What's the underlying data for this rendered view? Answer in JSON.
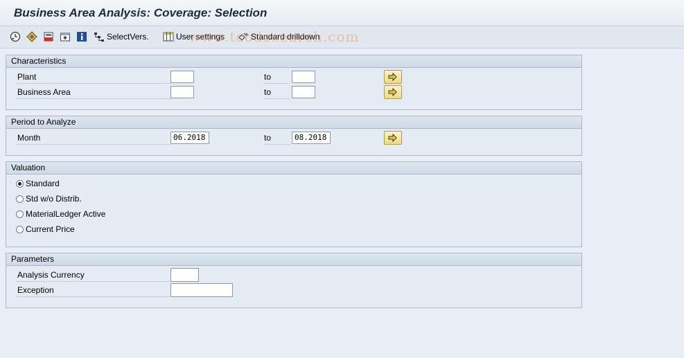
{
  "window": {
    "title": "Business Area Analysis: Coverage: Selection"
  },
  "toolbar": {
    "select_versions_label": "SelectVers.",
    "user_settings_label": "User settings",
    "standard_drilldown_label": "Standard drilldown"
  },
  "watermark": "www.tcodesearch.com",
  "characteristics": {
    "header": "Characteristics",
    "plant_label": "Plant",
    "plant_from": "",
    "plant_to": "",
    "business_area_label": "Business Area",
    "business_area_from": "",
    "business_area_to": "",
    "to_label": "to"
  },
  "period": {
    "header": "Period to Analyze",
    "month_label": "Month",
    "month_from": "06.2018",
    "month_to": "08.2018",
    "to_label": "to"
  },
  "valuation": {
    "header": "Valuation",
    "options": [
      "Standard",
      "Std w/o Distrib.",
      "MaterialLedger Active",
      "Current Price"
    ],
    "selected": "Standard"
  },
  "parameters": {
    "header": "Parameters",
    "analysis_currency_label": "Analysis Currency",
    "analysis_currency_value": "",
    "exception_label": "Exception",
    "exception_value": ""
  }
}
